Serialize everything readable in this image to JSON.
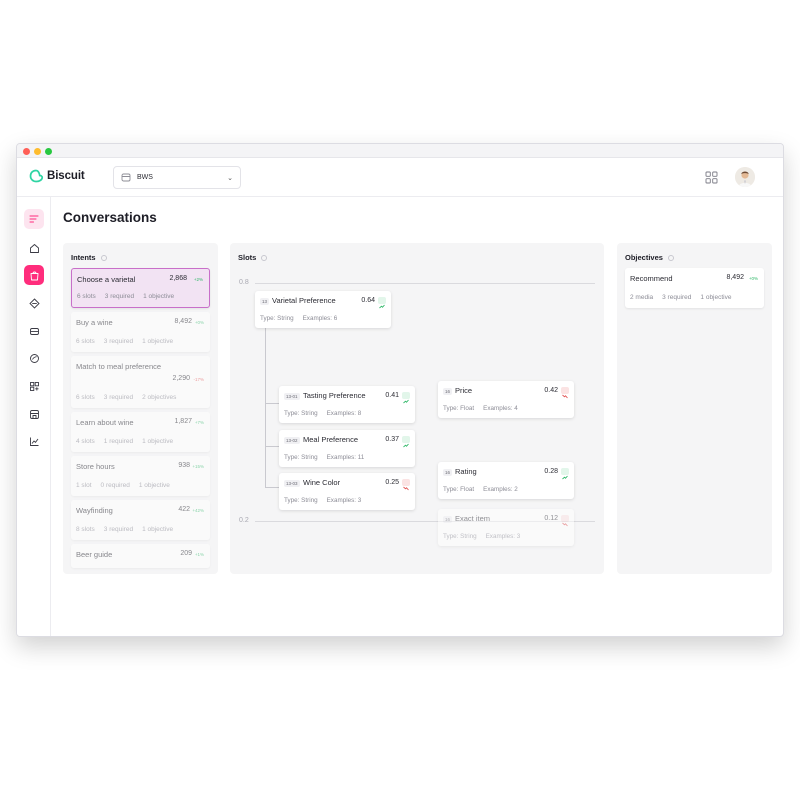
{
  "app": {
    "name": "Biscuit",
    "workspace": "BWS"
  },
  "page": {
    "title": "Conversations"
  },
  "colors": {
    "accent": "#ff2d7c",
    "selected_bg": "#f2e3f3",
    "selected_border": "#c86fc9",
    "trend_up": "#2fb868",
    "trend_down": "#e25454"
  },
  "sidebar": {
    "icons": [
      "menu-icon",
      "home-icon",
      "shopping-bag-icon",
      "diamond-icon",
      "chip-icon",
      "chat-icon",
      "blocks-icon",
      "store-icon",
      "chart-icon"
    ],
    "active": "shopping-bag-icon"
  },
  "intents": {
    "title": "Intents",
    "items": [
      {
        "name": "Choose a varietal",
        "count": "2,868",
        "trend": "+2%",
        "dir": "up",
        "slots": "6 slots",
        "required": "3 required",
        "objective": "1 objective",
        "selected": true
      },
      {
        "name": "Buy a wine",
        "count": "8,492",
        "trend": "+0%",
        "dir": "up",
        "slots": "6 slots",
        "required": "3 required",
        "objective": "1 objective"
      },
      {
        "name": "Match to meal preference",
        "count": "2,290",
        "trend": "-17%",
        "dir": "down",
        "slots": "6 slots",
        "required": "3 required",
        "objective": "2 objectives"
      },
      {
        "name": "Learn about wine",
        "count": "1,827",
        "trend": "+7%",
        "dir": "up",
        "slots": "4 slots",
        "required": "1 required",
        "objective": "1 objective"
      },
      {
        "name": "Store hours",
        "count": "938",
        "trend": "+15%",
        "dir": "up",
        "slots": "1 slot",
        "required": "0 required",
        "objective": "1 objective"
      },
      {
        "name": "Wayfinding",
        "count": "422",
        "trend": "+42%",
        "dir": "up",
        "slots": "8 slots",
        "required": "3 required",
        "objective": "1 objective"
      },
      {
        "name": "Beer guide",
        "count": "209",
        "trend": "+1%",
        "dir": "up",
        "slots": "",
        "required": "",
        "objective": ""
      }
    ]
  },
  "slots": {
    "title": "Slots",
    "scale_top": "0.8",
    "scale_bottom": "0.2",
    "items": [
      {
        "id": "13",
        "name": "Varietal Preference",
        "score": "0.64",
        "dir": "up",
        "type": "Type: String",
        "examples": "Examples: 6"
      },
      {
        "id": "13-01",
        "name": "Tasting Preference",
        "score": "0.41",
        "dir": "up",
        "type": "Type: String",
        "examples": "Examples: 8"
      },
      {
        "id": "13-02",
        "name": "Meal Preference",
        "score": "0.37",
        "dir": "up",
        "type": "Type: String",
        "examples": "Examples: 11"
      },
      {
        "id": "13-03",
        "name": "Wine Color",
        "score": "0.25",
        "dir": "down",
        "type": "Type: String",
        "examples": "Examples: 3"
      },
      {
        "id": "16",
        "name": "Price",
        "score": "0.42",
        "dir": "down",
        "type": "Type: Float",
        "examples": "Examples: 4"
      },
      {
        "id": "16",
        "name": "Rating",
        "score": "0.28",
        "dir": "up",
        "type": "Type: Float",
        "examples": "Examples: 2"
      },
      {
        "id": "16",
        "name": "Exact item",
        "score": "0.12",
        "dir": "down",
        "type": "Type: String",
        "examples": "Examples: 3",
        "faded": true
      }
    ]
  },
  "objectives": {
    "title": "Objectives",
    "items": [
      {
        "name": "Recommend",
        "count": "8,492",
        "trend": "+0%",
        "dir": "up",
        "media": "2 media",
        "required": "3 required",
        "objective": "1 objective"
      }
    ]
  }
}
